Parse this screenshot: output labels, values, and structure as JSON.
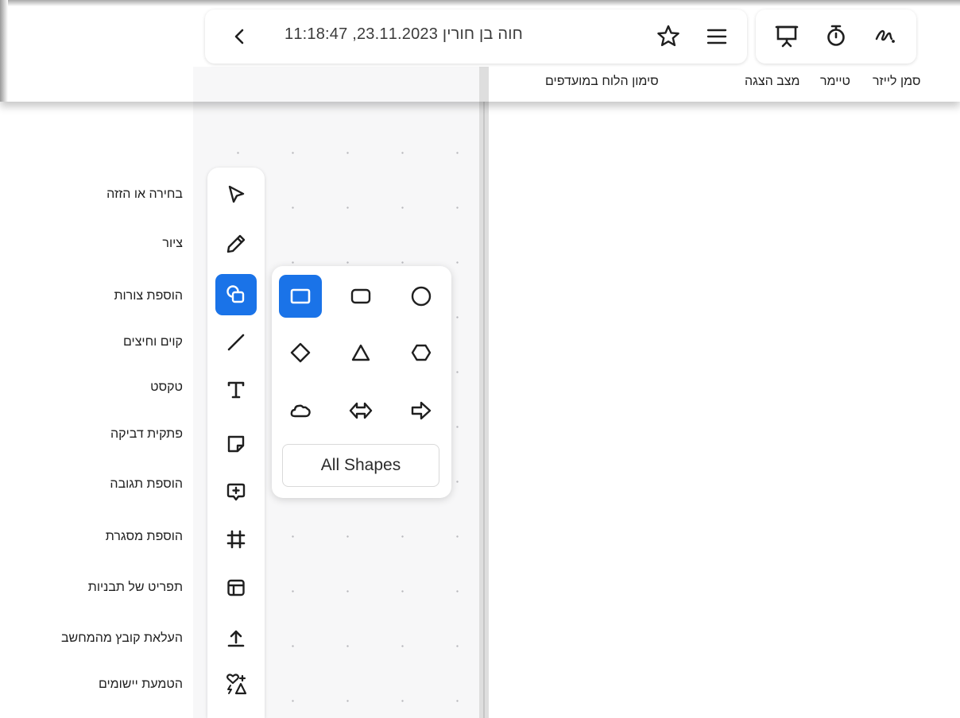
{
  "header": {
    "board_title": "חוה בן חורין 23.11.2023, 11:18:47",
    "back_icon": "chevron-left-icon",
    "star_icon": "star-outline-icon",
    "menu_icon": "hamburger-menu-icon"
  },
  "top_tools": {
    "items": [
      {
        "icon": "present-icon",
        "caption": "מצב הצגה"
      },
      {
        "icon": "timer-icon",
        "caption": "טיימר"
      },
      {
        "icon": "laser-pointer-icon",
        "caption": "סמן לייזר"
      }
    ],
    "favorites_caption": "סימון הלוח במועדפים"
  },
  "left_toolbar": {
    "items": [
      {
        "label": "בחירה או הזזה",
        "icon": "select-cursor-icon",
        "active": false
      },
      {
        "label": "ציור",
        "icon": "pen-icon",
        "active": false
      },
      {
        "label": "הוספת צורות",
        "icon": "shapes-icon",
        "active": true
      },
      {
        "label": "קוים וחיצים",
        "icon": "line-icon",
        "active": false
      },
      {
        "label": "טקסט",
        "icon": "text-icon",
        "active": false
      },
      {
        "label": "פתקית דביקה",
        "icon": "sticky-note-icon",
        "active": false
      },
      {
        "label": "הוספת תגובה",
        "icon": "add-comment-icon",
        "active": false
      },
      {
        "label": "הוספת מסגרת",
        "icon": "frame-icon",
        "active": false
      },
      {
        "label": "תפריט של תבניות",
        "icon": "templates-icon",
        "active": false
      },
      {
        "label": "העלאת קובץ מהמחשב",
        "icon": "upload-icon",
        "active": false
      },
      {
        "label": "הטמעת יישומים",
        "icon": "apps-icon",
        "active": false
      }
    ]
  },
  "shapes_popup": {
    "shapes": [
      "rectangle-icon",
      "rounded-rectangle-icon",
      "circle-icon",
      "diamond-icon",
      "triangle-icon",
      "hexagon-icon",
      "cloud-icon",
      "double-arrow-icon",
      "right-arrow-icon"
    ],
    "selected": "rectangle-icon",
    "all_shapes_label": "All Shapes"
  },
  "colors": {
    "accent": "#1a73e8",
    "icon": "#1f1f1f",
    "canvas": "#f7f7f8",
    "dot": "#b8b8bd"
  }
}
